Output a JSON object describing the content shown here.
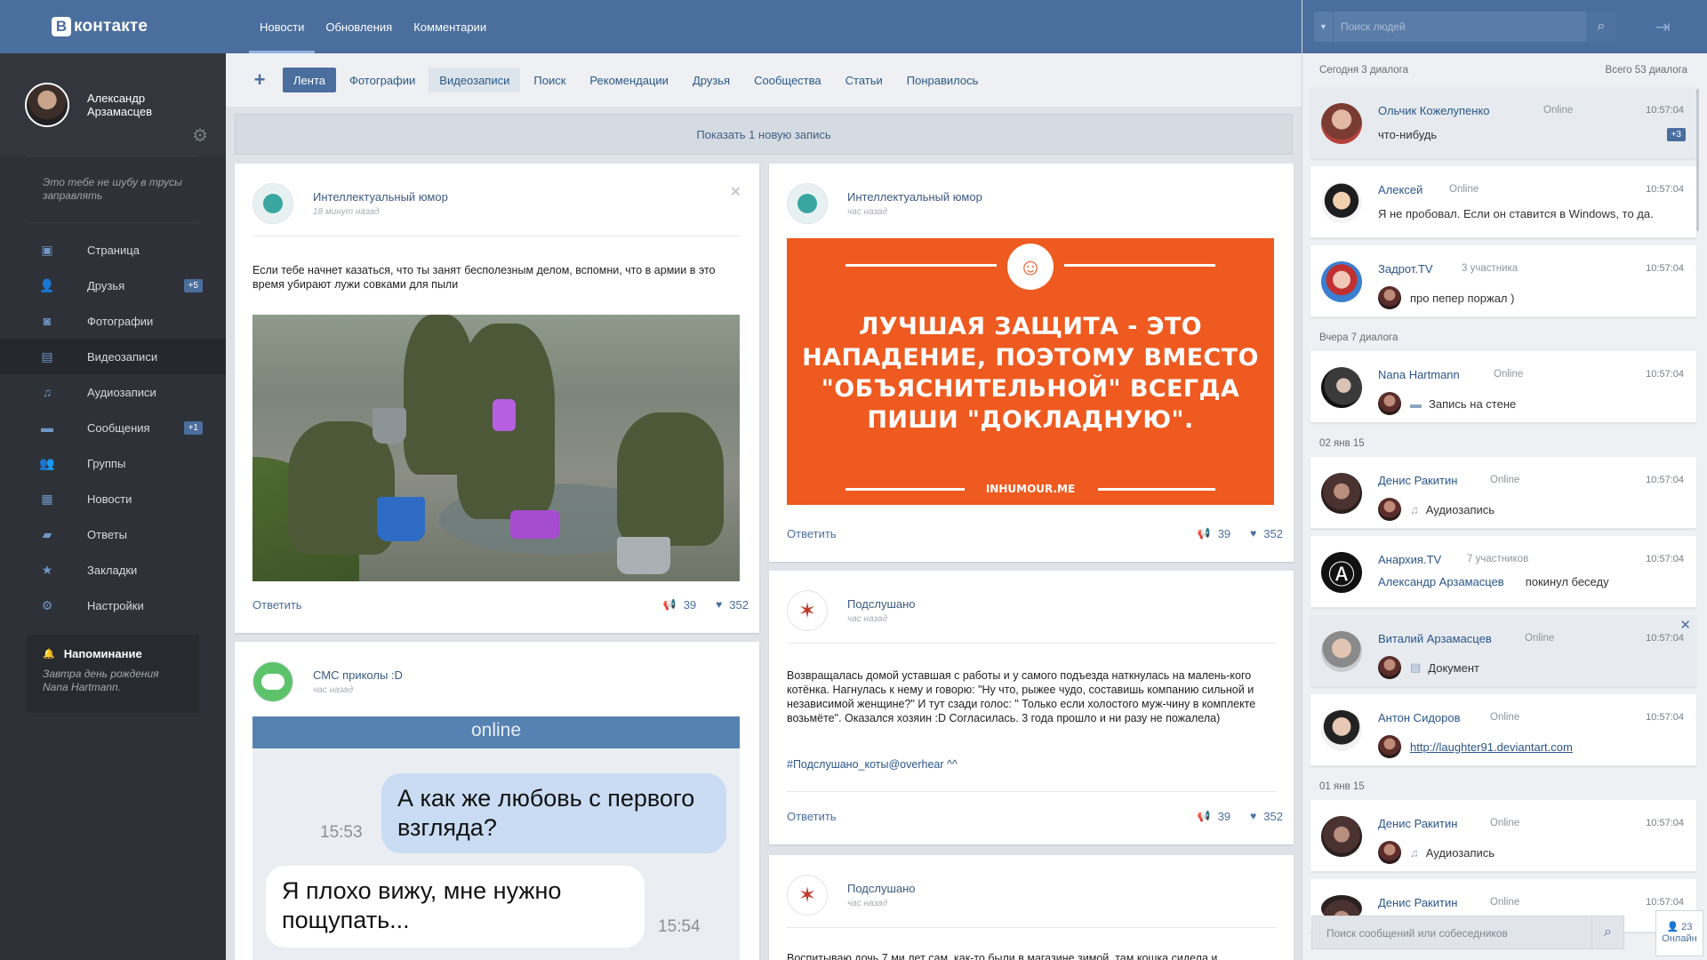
{
  "brand": {
    "logo_letter": "В",
    "logo_text": "контакте"
  },
  "profile": {
    "name": "Александр Арзамасцев",
    "status": "Это тебе не шубу в трусы заправлять"
  },
  "menu": [
    {
      "label": "Страница",
      "icon": "page-icon",
      "glyph": "▣"
    },
    {
      "label": "Друзья",
      "icon": "friends-icon",
      "glyph": "👤",
      "badge": "+5"
    },
    {
      "label": "Фотографии",
      "icon": "camera-icon",
      "glyph": "◙"
    },
    {
      "label": "Видеозаписи",
      "icon": "film-icon",
      "glyph": "▤",
      "active": true
    },
    {
      "label": "Аудиозаписи",
      "icon": "music-icon",
      "glyph": "♫"
    },
    {
      "label": "Сообщения",
      "icon": "chat-icon",
      "glyph": "▬",
      "badge": "+1"
    },
    {
      "label": "Группы",
      "icon": "groups-icon",
      "glyph": "👥"
    },
    {
      "label": "Новости",
      "icon": "news-icon",
      "glyph": "▦"
    },
    {
      "label": "Ответы",
      "icon": "answers-icon",
      "glyph": "▰"
    },
    {
      "label": "Закладки",
      "icon": "star-icon",
      "glyph": "★"
    },
    {
      "label": "Настройки",
      "icon": "gear-icon",
      "glyph": "⚙"
    }
  ],
  "reminder": {
    "title": "Напоминание",
    "text": "Завтра день рождения Nana Hartmann."
  },
  "top_tabs": [
    "Новости",
    "Обновления",
    "Комментарии"
  ],
  "sub_tabs": [
    "Лента",
    "Фотографии",
    "Видеозаписи",
    "Поиск",
    "Рекомендации",
    "Друзья",
    "Сообщества",
    "Статьи",
    "Понравилось"
  ],
  "feed": {
    "new_post": "Показать 1 новую запись",
    "reply_label": "Ответить",
    "posts": [
      {
        "author": "Интеллектуальный юмор",
        "time": "18 минут назад",
        "text": "Если тебе начнет казаться, что ты занят бесполезным делом, вспомни, что в армии в это время убирают лужи совками для пыли",
        "reposts": "39",
        "likes": "352"
      },
      {
        "author": "Интеллектуальный юмор",
        "time": "час назад",
        "image_text": "ЛУЧШАЯ ЗАЩИТА - ЭТО НАПАДЕНИЕ, ПОЭТОМУ ВМЕСТО \"ОБЪЯСНИТЕЛЬНОЙ\" ВСЕГДА ПИШИ \"ДОКЛАДНУЮ\".",
        "image_site": "INHUMOUR.ME",
        "reposts": "39",
        "likes": "352"
      },
      {
        "author": "СМС приколы :D",
        "time": "час назад",
        "chat_header": "online",
        "bubble1": "А как же любовь с первого взгляда?",
        "time1": "15:53",
        "bubble2": "Я плохо вижу, мне нужно пощупать...",
        "time2": "15:54"
      },
      {
        "author": "Подслушано",
        "time": "час назад",
        "text": "Возвращалась домой уставшая с работы и у самого подъезда наткнулась на малень-кого котёнка. Нагнулась к нему и говорю: \"Ну что, рыжее чудо, составишь компанию сильной и независимой женщине?\" И тут сзади голос: \" Только если холостого муж-чину в комплекте возьмёте\". Оказался хозяин :D Согласилась. 3 года прошло и ни разу не пожалела)",
        "hashtag": "#Подслушано_коты@overhear ^^",
        "reposts": "39",
        "likes": "352"
      },
      {
        "author": "Подслушано",
        "time": "час назад",
        "text": "Воспитываю дочь 7 ми лет сам, как-то были в магазине зимой, там кошка сидела и"
      }
    ]
  },
  "right": {
    "search_placeholder": "Поиск людей",
    "today_label": "Сегодня 3 диалога",
    "total_label": "Всего 53 диалога",
    "yesterday_label": "Вчера 7 диалога",
    "date1": "02 янв 15",
    "date2": "01 янв 15",
    "dialogs": [
      {
        "name": "Ольчик Кожелупенко",
        "status": "Online",
        "time": "10:57:04",
        "msg": "что-нибудь",
        "badge": "+3"
      },
      {
        "name": "Алексей",
        "status": "Online",
        "time": "10:57:04",
        "msg": "Я не пробовал. Если он ставится в Windows, то да."
      },
      {
        "name": "Задрот.TV",
        "status": "3 участника",
        "time": "10:57:04",
        "msg": "про пепер поржал )"
      },
      {
        "name": "Nana Hartmann",
        "status": "Online",
        "time": "10:57:04",
        "msg": "Запись на стене"
      },
      {
        "name": "Денис Ракитин",
        "status": "Online",
        "time": "10:57:04",
        "msg": "Аудиозапись"
      },
      {
        "name": "Анархия.TV",
        "status": "7 участников",
        "time": "10:57:04",
        "msg_name": "Александр Арзамасцев",
        "msg": "покинул беседу"
      },
      {
        "name": "Виталий Арзамасцев",
        "status": "Online",
        "time": "10:57:04",
        "msg": "Документ"
      },
      {
        "name": "Антон Сидоров",
        "status": "Online",
        "time": "10:57:04",
        "msg": "http://laughter91.deviantart.com"
      },
      {
        "name": "Денис Ракитин",
        "status": "Online",
        "time": "10:57:04",
        "msg": "Аудиозапись"
      },
      {
        "name": "Денис Ракитин",
        "status": "Online",
        "time": "10:57:04"
      }
    ],
    "msg_search_placeholder": "Поиск сообщений или собеседников",
    "online_count": "23",
    "online_label": "Онлайн"
  },
  "colors": {
    "brand": "#4a6e9d",
    "sidebar": "#2e3137",
    "accent_orange": "#ee5a1f"
  }
}
